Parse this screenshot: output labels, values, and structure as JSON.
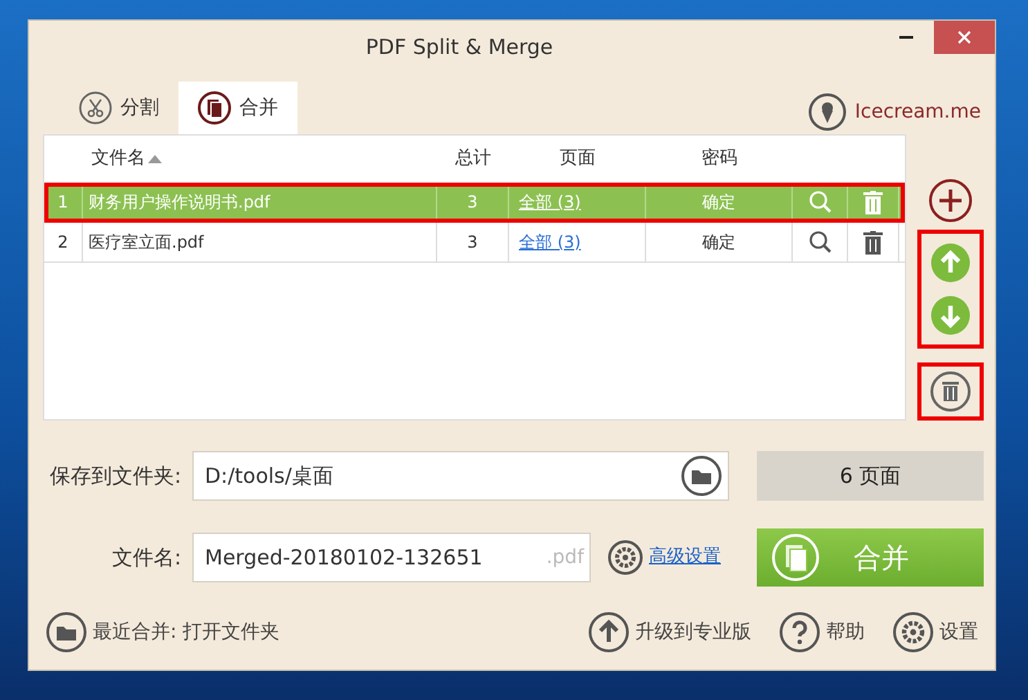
{
  "window": {
    "title": "PDF Split & Merge"
  },
  "tabs": [
    {
      "label": "分割",
      "kind": "split",
      "selected": false
    },
    {
      "label": "合并",
      "kind": "merge",
      "selected": true
    }
  ],
  "brand": {
    "label": "Icecream.me"
  },
  "table": {
    "columns": [
      {
        "label": "文件名",
        "sorted": true
      },
      {
        "label": "总计",
        "sorted": false
      },
      {
        "label": "页面",
        "sorted": false
      },
      {
        "label": "密码",
        "sorted": false
      }
    ],
    "rows": [
      {
        "index": "1",
        "name": "财务用户操作说明书.pdf",
        "total": "3",
        "pages": "全部 (3)",
        "password": "确定",
        "selected": true,
        "highlighted": true
      },
      {
        "index": "2",
        "name": "医疗室立面.pdf",
        "total": "3",
        "pages": "全部 (3)",
        "password": "确定",
        "selected": false,
        "highlighted": false
      }
    ]
  },
  "side_actions": {
    "move_highlighted": true,
    "clear_highlighted": true
  },
  "save_folder": {
    "label": "保存到文件夹:",
    "value": "D:/tools/桌面"
  },
  "page_count": "6 页面",
  "file_name": {
    "label": "文件名:",
    "value": "Merged-20180102-132651",
    "extension": ".pdf"
  },
  "advanced_link": "高级设置",
  "merge_button": "合并",
  "footer": {
    "recent": "最近合并: 打开文件夹",
    "upgrade": "升级到专业版",
    "help": "帮助",
    "settings": "设置"
  }
}
